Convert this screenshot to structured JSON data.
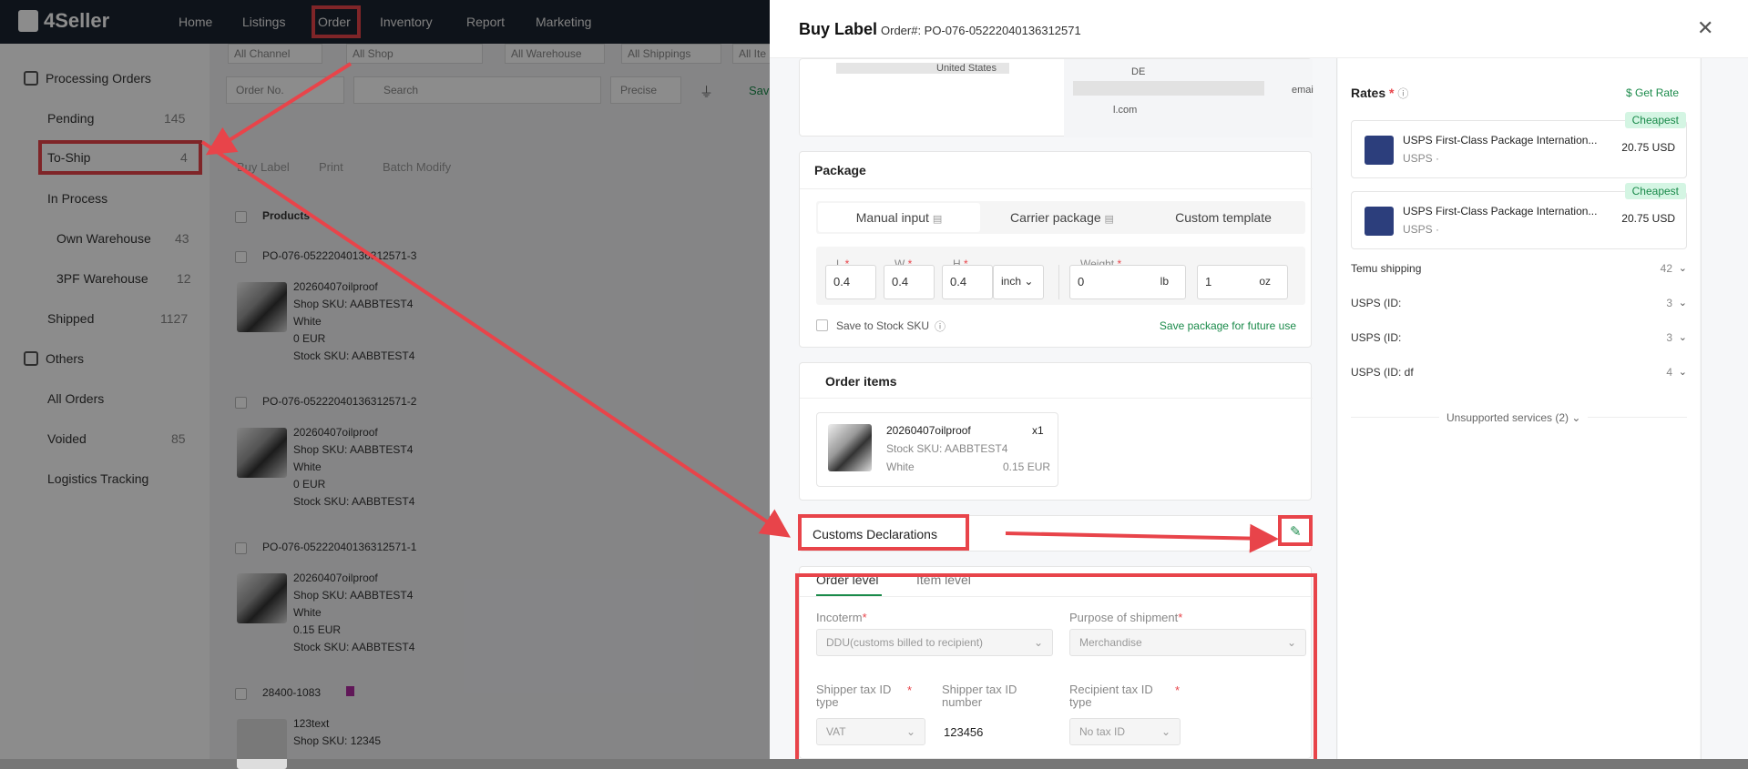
{
  "app": {
    "logo": "4Seller",
    "nav": [
      "Home",
      "Listings",
      "Order",
      "Inventory",
      "Report",
      "Marketing"
    ],
    "filters": [
      "All Channel",
      "All Shop",
      "All Warehouse",
      "All Shippings",
      "All Ite"
    ],
    "order_no_select": "Order No.",
    "search_placeholder": "Search",
    "precise_select": "Precise",
    "save_label": "Sav",
    "actions": [
      "Buy Label",
      "Print",
      "Batch Modify"
    ],
    "products_header": "Products"
  },
  "sidebar": {
    "processing_title": "Processing Orders",
    "items": [
      {
        "label": "Pending",
        "count": "145"
      },
      {
        "label": "To-Ship",
        "count": "4"
      },
      {
        "label": "In Process",
        "count": ""
      },
      {
        "label": "Own Warehouse",
        "count": "43"
      },
      {
        "label": "3PF Warehouse",
        "count": "12"
      },
      {
        "label": "Shipped",
        "count": "1127"
      }
    ],
    "others_title": "Others",
    "others": [
      {
        "label": "All Orders",
        "count": ""
      },
      {
        "label": "Voided",
        "count": "85"
      },
      {
        "label": "Logistics Tracking",
        "count": ""
      }
    ]
  },
  "orders": [
    {
      "id": "PO-076-05222040136312571-3",
      "name": "20260407oilproof",
      "shop_sku": "Shop SKU: AABBTEST4",
      "color": "White",
      "price": "0 EUR",
      "stock_sku": "Stock SKU: AABBTEST4"
    },
    {
      "id": "PO-076-05222040136312571-2",
      "name": "20260407oilproof",
      "shop_sku": "Shop SKU: AABBTEST4",
      "color": "White",
      "price": "0 EUR",
      "stock_sku": "Stock SKU: AABBTEST4"
    },
    {
      "id": "PO-076-05222040136312571-1",
      "name": "20260407oilproof",
      "shop_sku": "Shop SKU: AABBTEST4",
      "color": "White",
      "price": "0.15 EUR",
      "stock_sku": "Stock SKU: AABBTEST4"
    },
    {
      "id": "28400-1083",
      "name": "123text",
      "shop_sku": "Shop SKU: 12345",
      "color": "",
      "price": "",
      "stock_sku": ""
    }
  ],
  "drawer": {
    "title": "Buy Label",
    "order_no": "Order#: PO-076-05222040136312571",
    "address_left": "United States",
    "address_right_1": "DE",
    "address_right_2": "emai",
    "address_right_3": "l.com",
    "package": {
      "title": "Package",
      "tabs": [
        "Manual input",
        "Carrier package",
        "Custom template"
      ],
      "L_label": "L",
      "L_value": "0.4",
      "W_label": "W",
      "W_value": "0.4",
      "H_label": "H",
      "H_value": "0.4",
      "dim_unit": "inch",
      "weight_label": "Weight",
      "weight_value": "0",
      "weight_unit": "lb",
      "oz_value": "1",
      "oz_unit": "oz",
      "save_stock": "Save to Stock SKU",
      "save_future": "Save package for future use"
    },
    "order_items": {
      "title": "Order items",
      "name": "20260407oilproof",
      "qty": "x1",
      "stock_sku": "Stock SKU: AABBTEST4",
      "color": "White",
      "price": "0.15 EUR"
    },
    "customs": {
      "title": "Customs Declarations",
      "tabs": [
        "Order level",
        "Item level"
      ],
      "incoterm_label": "Incoterm",
      "incoterm_value": "DDU(customs billed to recipient)",
      "purpose_label": "Purpose of shipment",
      "purpose_value": "Merchandise",
      "shipper_tax_type_label": "Shipper tax ID type",
      "shipper_tax_type_value": "VAT",
      "shipper_tax_num_label": "Shipper tax ID number",
      "shipper_tax_num_value": "123456",
      "recipient_tax_label": "Recipient tax ID type",
      "recipient_tax_value": "No tax ID"
    },
    "rates": {
      "title": "Rates",
      "get_rate": "Get Rate",
      "cards": [
        {
          "name": "USPS First-Class Package Internation...",
          "carrier": "USPS ·",
          "price": "20.75 USD",
          "badge": "Cheapest"
        },
        {
          "name": "USPS First-Class Package Internation...",
          "carrier": "USPS ·",
          "price": "20.75 USD",
          "badge": "Cheapest"
        }
      ],
      "groups": [
        {
          "label": "Temu shipping",
          "count": "42"
        },
        {
          "label": "USPS (ID:",
          "count": "3"
        },
        {
          "label": "USPS (ID:",
          "count": "3"
        },
        {
          "label": "USPS (ID: df",
          "count": "4"
        }
      ],
      "unsupported": "Unsupported services (2)"
    }
  },
  "colors": {
    "accent": "#e8444a",
    "green": "#1a8a4a",
    "nav_bg": "#1b2330"
  }
}
